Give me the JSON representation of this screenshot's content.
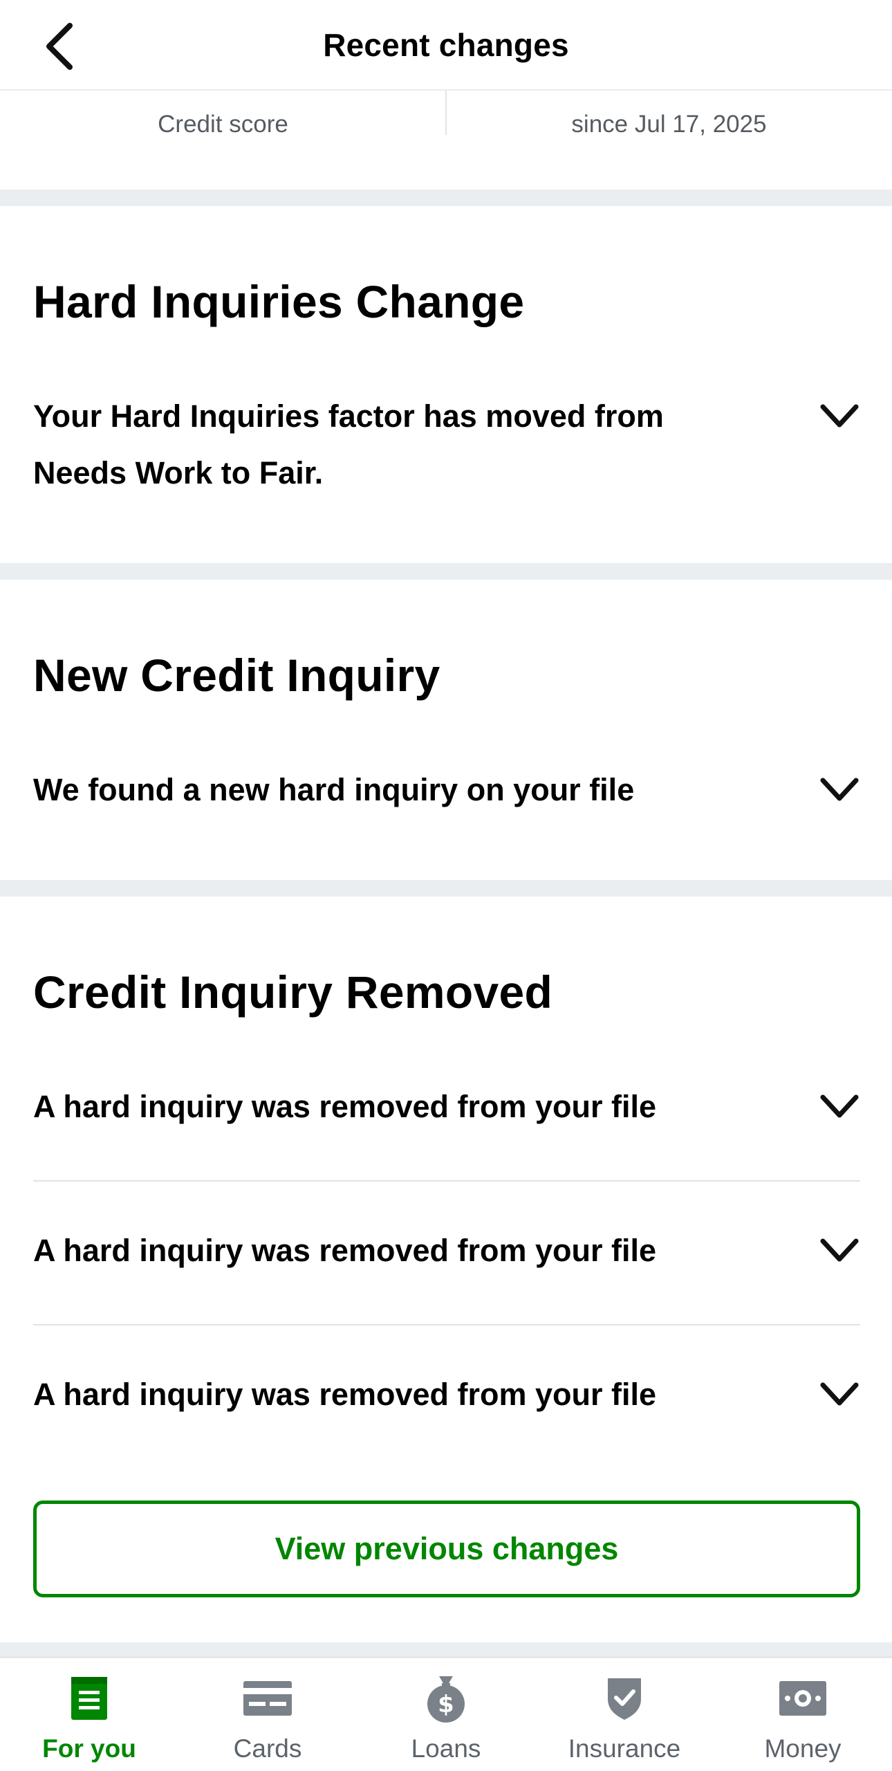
{
  "header": {
    "title": "Recent changes",
    "back_icon": "chevron-left-icon"
  },
  "summary": {
    "left_label": "Credit score",
    "right_label": "since Jul 17, 2025"
  },
  "sections": [
    {
      "title": "Hard Inquiries Change",
      "rows": [
        {
          "text": "Your Hard Inquiries factor has moved from Needs Work to Fair."
        }
      ]
    },
    {
      "title": "New Credit Inquiry",
      "rows": [
        {
          "text": "We found a new hard inquiry on your file"
        }
      ]
    },
    {
      "title": "Credit Inquiry Removed",
      "rows": [
        {
          "text": "A hard inquiry was removed from your file"
        },
        {
          "text": "A hard inquiry was removed from your file"
        },
        {
          "text": "A hard inquiry was removed from your file"
        }
      ]
    }
  ],
  "view_previous_label": "View previous changes",
  "bottom_nav": {
    "items": [
      {
        "label": "For you",
        "icon": "document-icon",
        "active": true
      },
      {
        "label": "Cards",
        "icon": "credit-card-icon",
        "active": false
      },
      {
        "label": "Loans",
        "icon": "money-bag-icon",
        "active": false
      },
      {
        "label": "Insurance",
        "icon": "shield-check-icon",
        "active": false
      },
      {
        "label": "Money",
        "icon": "cash-icon",
        "active": false
      }
    ]
  },
  "colors": {
    "accent": "#008600",
    "inactive": "#5c636a",
    "icon_gray": "#7a8188",
    "separator": "#eaeef1"
  }
}
